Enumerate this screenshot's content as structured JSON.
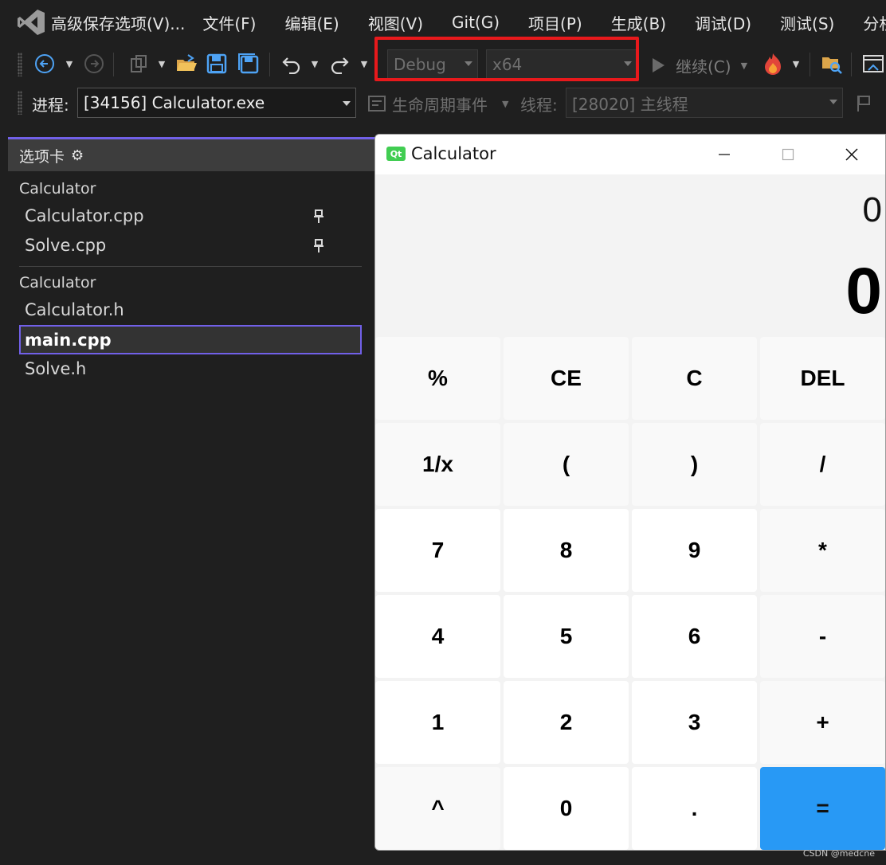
{
  "menubar": {
    "title": "高级保存选项(V)...",
    "items": [
      "文件(F)",
      "编辑(E)",
      "视图(V)",
      "Git(G)",
      "项目(P)",
      "生成(B)",
      "调试(D)",
      "测试(S)",
      "分析"
    ]
  },
  "toolbar": {
    "config": "Debug",
    "platform": "x64",
    "continue_label": "继续(C)",
    "highlight_color": "#e8191c"
  },
  "toolbar2": {
    "process_label": "进程:",
    "process_value": "[34156] Calculator.exe",
    "lifecycle_label": "生命周期事件",
    "thread_label": "线程:",
    "thread_value": "[28020] 主线程"
  },
  "panel": {
    "header": "选项卡",
    "groups": [
      {
        "title": "Calculator",
        "files": [
          "Calculator.cpp",
          "Solve.cpp"
        ]
      },
      {
        "title": "Calculator",
        "files": [
          "Calculator.h",
          "main.cpp",
          "Solve.h"
        ]
      }
    ],
    "active_file": "main.cpp",
    "accent": "#7160e8"
  },
  "calculator": {
    "title": "Calculator",
    "icon_text": "Qt",
    "expression": "0",
    "result": "0",
    "keys": [
      [
        "%",
        "CE",
        "C",
        "DEL"
      ],
      [
        "1/x",
        "(",
        ")",
        "/"
      ],
      [
        "7",
        "8",
        "9",
        "*"
      ],
      [
        "4",
        "5",
        "6",
        "-"
      ],
      [
        "1",
        "2",
        "3",
        "+"
      ],
      [
        "^",
        "0",
        ".",
        "="
      ]
    ],
    "equals_color": "#2899f5"
  },
  "watermark": "CSDN @medcne"
}
